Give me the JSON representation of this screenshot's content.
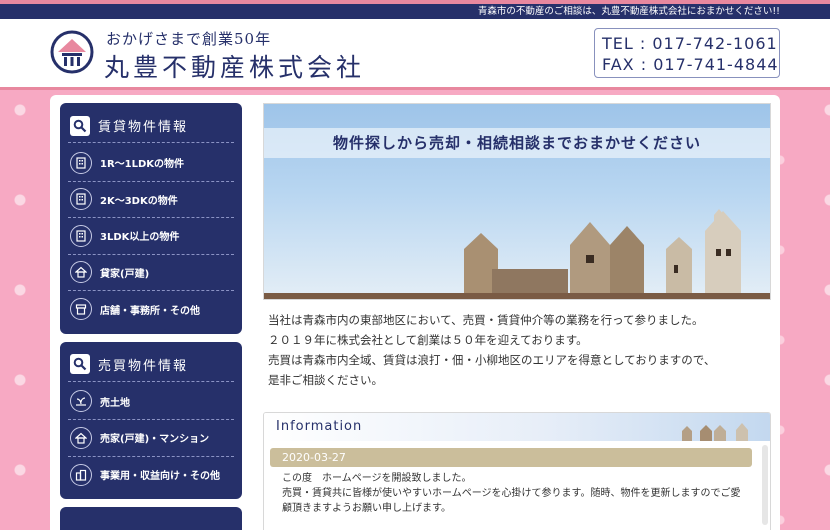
{
  "notice": "青森市の不動産のご相談は、丸豊不動産株式会社におまかせください!!",
  "header": {
    "tagline": "おかげさまで創業50年",
    "company": "丸豊不動産株式会社",
    "tel": "TEL : 017-742-1061",
    "fax": "FAX : 017-741-4844"
  },
  "sidebar": {
    "rental": {
      "title": "賃貸物件情報",
      "items": [
        "1R〜1LDKの物件",
        "2K〜3DKの物件",
        "3LDK以上の物件",
        "貸家(戸建)",
        "店舗・事務所・その他"
      ]
    },
    "sale": {
      "title": "売買物件情報",
      "items": [
        "売土地",
        "売家(戸建)・マンション",
        "事業用・収益向け・その他"
      ]
    }
  },
  "hero": {
    "caption": "物件探しから売却・相続相談までおまかせください"
  },
  "intro": {
    "lines": [
      "当社は青森市内の東部地区において、売買・賃貸仲介等の業務を行って参りました。",
      "２０１９年に株式会社として創業は５０年を迎えております。",
      "売買は青森市内全域、賃貸は浪打・佃・小柳地区のエリアを得意としておりますので、",
      "是非ご相談ください。"
    ]
  },
  "information": {
    "title": "Information",
    "news": [
      {
        "date": "2020-03-27",
        "lines": [
          "この度　ホームページを開設致しました。",
          "売買・賃貸共に皆様が使いやすいホームページを心掛けて参ります。随時、物件を更新しますのでご愛",
          "顧頂きますようお願い申し上げます。"
        ]
      }
    ]
  },
  "colors": {
    "navy": "#26306a",
    "pink": "#f7a9c3",
    "accent": "#e8889f",
    "beige": "#cbbe9b"
  }
}
